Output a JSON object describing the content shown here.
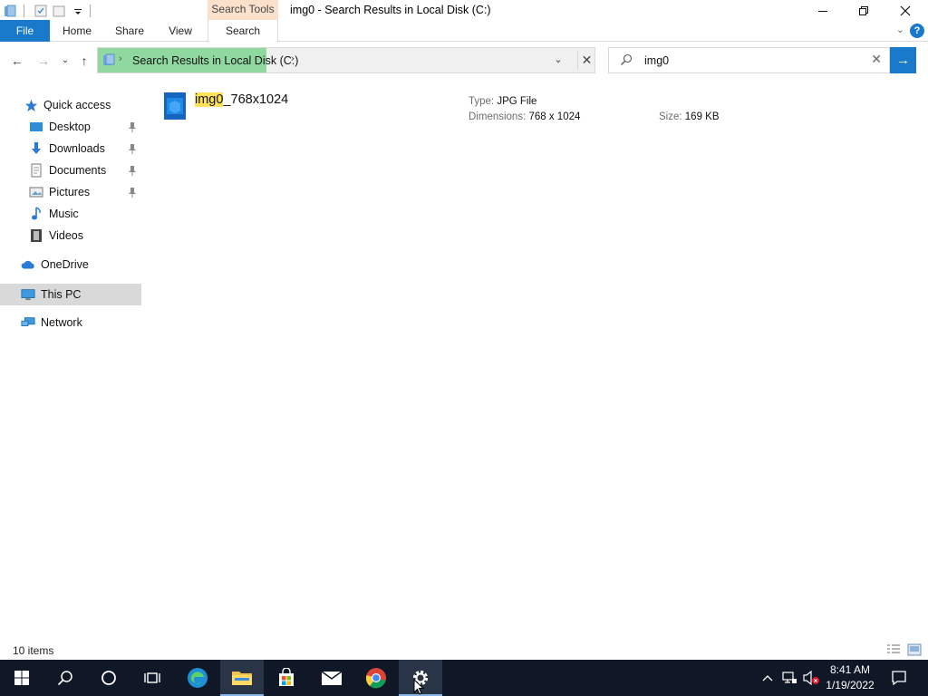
{
  "window": {
    "title": "img0 - Search Results in Local Disk (C:)",
    "context_tab": "Search Tools"
  },
  "ribbon": {
    "tabs": [
      "File",
      "Home",
      "Share",
      "View",
      "Search"
    ],
    "help": "?"
  },
  "nav": {
    "back": "←",
    "forward": "→",
    "recent": "⌄",
    "up": "↑"
  },
  "address": {
    "path": "Search Results in Local Disk (C:)",
    "sep": "›",
    "dropdown": "⌄",
    "close": "✕"
  },
  "search": {
    "query": "img0",
    "clear": "✕",
    "go": "→"
  },
  "sidebar": {
    "items": [
      {
        "label": "Quick access"
      },
      {
        "label": "Desktop"
      },
      {
        "label": "Downloads"
      },
      {
        "label": "Documents"
      },
      {
        "label": "Pictures"
      },
      {
        "label": "Music"
      },
      {
        "label": "Videos"
      },
      {
        "label": "OneDrive"
      },
      {
        "label": "This PC"
      },
      {
        "label": "Network"
      }
    ]
  },
  "results": [
    {
      "name_highlight": "img0",
      "name_rest": "_768x1024",
      "type_label": "Type:",
      "type_value": "JPG File",
      "dims_label": "Dimensions:",
      "dims_value": "768 x 1024",
      "size_label": "Size:",
      "size_value": "169 KB"
    }
  ],
  "status": {
    "items": "10 items"
  },
  "taskbar": {
    "time": "8:41 AM",
    "date": "1/19/2022"
  },
  "colors": {
    "accent": "#1979ca",
    "highlight": "#ffe15a",
    "address_highlight": "#8fd8a0",
    "taskbar": "#101828"
  }
}
